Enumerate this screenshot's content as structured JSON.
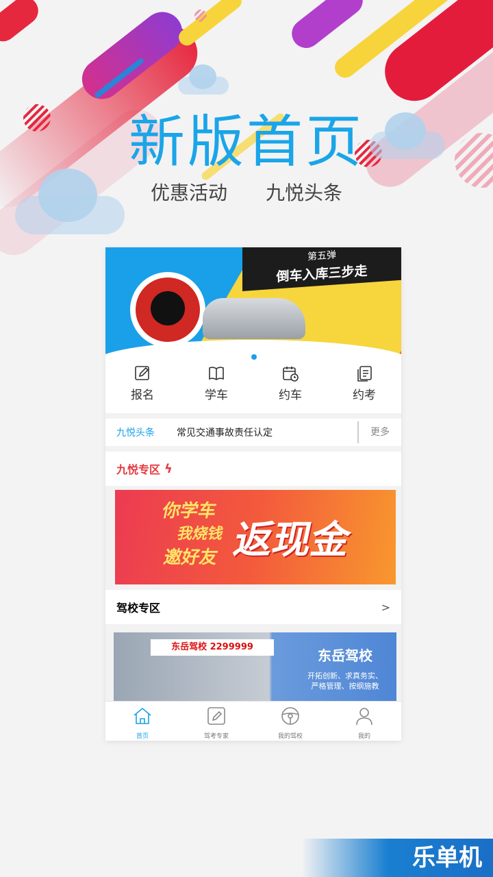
{
  "hero": {
    "title": "新版首页",
    "subtitles": [
      "优惠活动",
      "九悦头条"
    ]
  },
  "banner": {
    "line1": "第五弹",
    "line2": "倒车入库三步走"
  },
  "quick_nav": [
    {
      "label": "报名",
      "icon": "edit-icon"
    },
    {
      "label": "学车",
      "icon": "book-icon"
    },
    {
      "label": "约车",
      "icon": "calendar-clock-icon"
    },
    {
      "label": "约考",
      "icon": "document-copy-icon"
    }
  ],
  "news": {
    "tag": "九悦头条",
    "headline": "常见交通事故责任认定",
    "more": "更多"
  },
  "jiuyue_zone": {
    "title": "九悦专区",
    "promo": {
      "line1": "你学车",
      "line2": "我烧钱",
      "line3": "邀好友",
      "line4": "返现金"
    }
  },
  "school_zone": {
    "title": "驾校专区",
    "chevron": ">",
    "card": {
      "sign": "东岳驾校 2299999",
      "name": "东岳驾校",
      "desc_line1": "开拓创新、求真务实、",
      "desc_line2": "严格管理、按纲施教"
    }
  },
  "tabbar": [
    {
      "label": "首页",
      "icon": "home-icon",
      "active": true
    },
    {
      "label": "驾考专家",
      "icon": "pencil-box-icon",
      "active": false
    },
    {
      "label": "我的驾校",
      "icon": "steering-wheel-icon",
      "active": false
    },
    {
      "label": "我的",
      "icon": "person-icon",
      "active": false
    }
  ],
  "watermark": "乐单机",
  "colors": {
    "accent": "#1aa0e8",
    "red": "#e5383d",
    "background": "#f3f3f4"
  }
}
